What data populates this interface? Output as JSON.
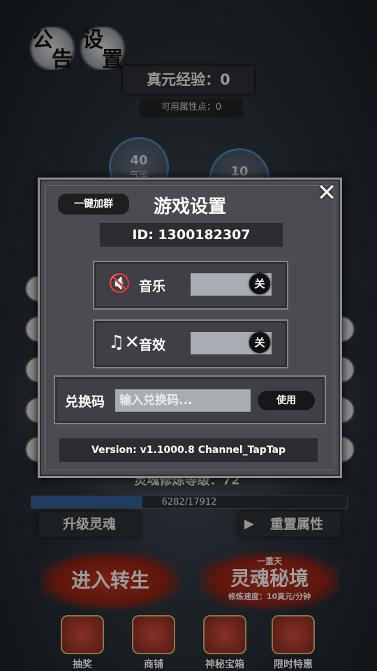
{
  "header": {
    "announce_chars": [
      "公",
      "告"
    ],
    "settings_chars": [
      "设",
      "置"
    ],
    "exp_label": "真元经验：0",
    "points_label": "可用属性点：0"
  },
  "stats": [
    {
      "value": "40",
      "label": "气运"
    },
    {
      "value": "10",
      "label": ""
    }
  ],
  "level": {
    "label": "灵魂修炼等级：72",
    "progress_text": "6282/17912",
    "progress_fraction": 0.3507
  },
  "actions": {
    "upgrade_label": "升级灵魂",
    "reset_label": "重置属性",
    "rebirth_label": "进入转生",
    "realm_top": "一重天",
    "realm_label": "灵魂秘境",
    "realm_speed": "修炼速度：10真元/分钟"
  },
  "nav": [
    {
      "label": "抽奖"
    },
    {
      "label": "商铺"
    },
    {
      "label": "神秘宝箱"
    },
    {
      "label": "限时特惠"
    }
  ],
  "dialog": {
    "group_button": "一键加群",
    "title": "游戏设置",
    "close_symbol": "✕",
    "id_text": "ID:  1300182307",
    "music": {
      "icon": "speaker-muted-icon",
      "label": "音乐",
      "state": "关"
    },
    "sfx": {
      "icon": "music-note-muted-icon",
      "label": "音效",
      "state": "关"
    },
    "redeem": {
      "label": "兑换码",
      "placeholder": "输入兑换码...",
      "use_label": "使用"
    },
    "version_text": "Version: v1.1000.8    Channel_TapTap"
  },
  "colors": {
    "dialog_bg": "#4a4c51",
    "progress_fill": "#2f5f93",
    "toggle_bg": "#a7adb3",
    "red_button": "#b8331f"
  }
}
